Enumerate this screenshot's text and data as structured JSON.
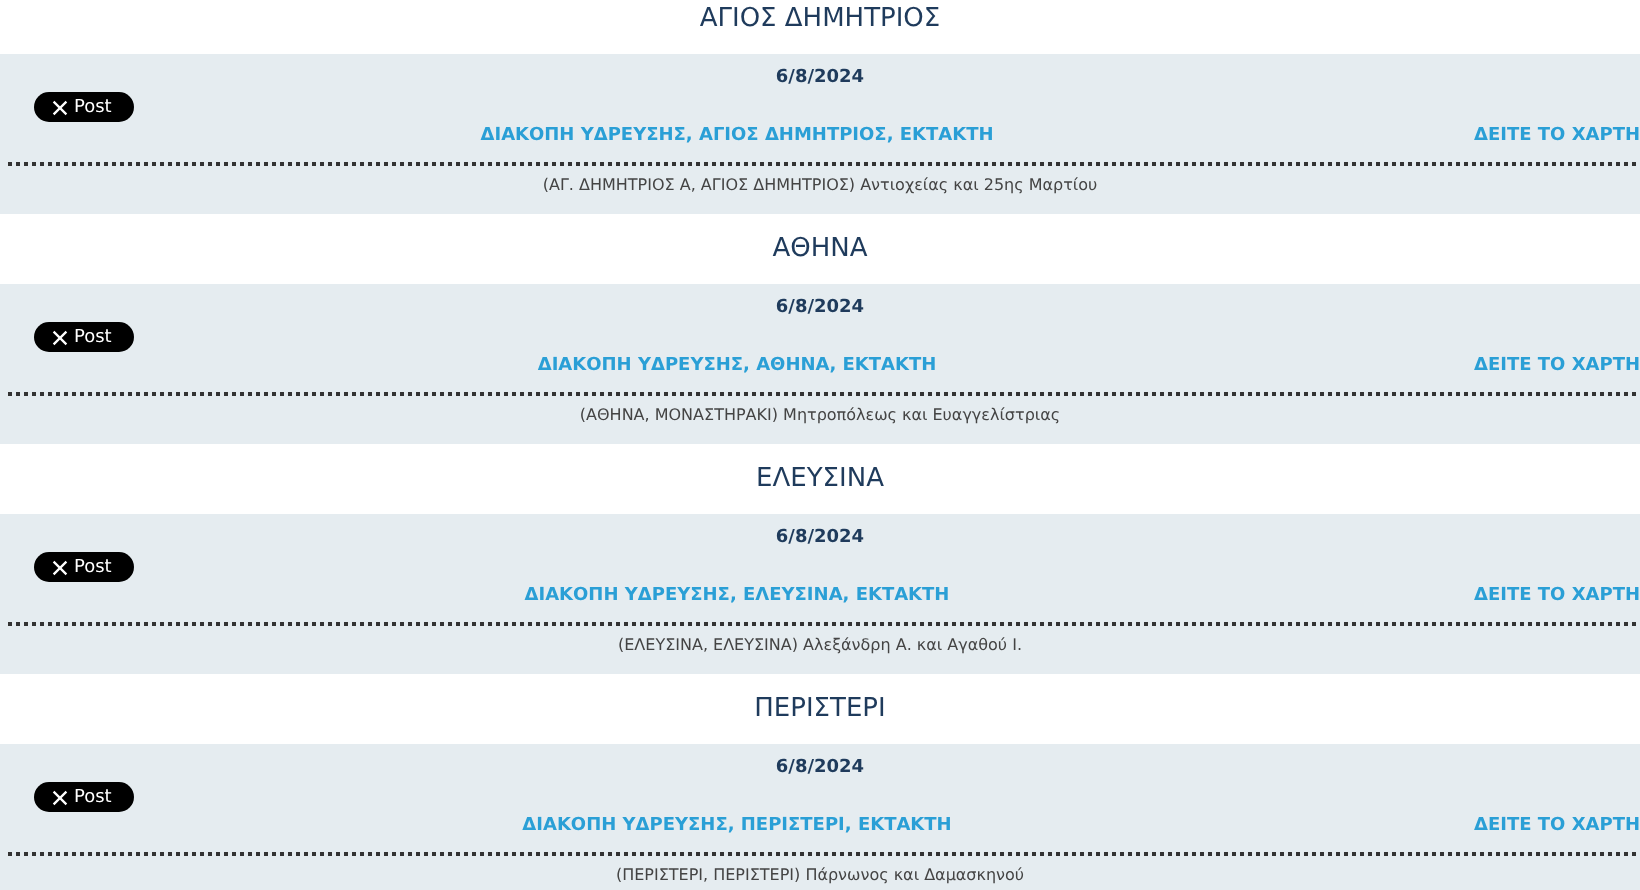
{
  "sections": [
    {
      "heading": "ΑΓΙΟΣ ΔΗΜΗΤΡΙΟΣ",
      "date": "6/8/2024",
      "post_button": "Post",
      "title": "ΔΙΑΚΟΠΗ ΥΔΡΕΥΣΗΣ, ΑΓΙΟΣ ΔΗΜΗΤΡΙΟΣ, ΕΚΤΑΚΤΗ",
      "map_link": "ΔΕΙΤΕ ΤΟ ΧΑΡΤΗ",
      "address": "(ΑΓ. ΔΗΜΗΤΡΙΟΣ Α, ΑΓΙΟΣ ΔΗΜΗΤΡΙΟΣ) Αντιοχείας και 25ης Μαρτίου"
    },
    {
      "heading": "ΑΘΗΝΑ",
      "date": "6/8/2024",
      "post_button": "Post",
      "title": "ΔΙΑΚΟΠΗ ΥΔΡΕΥΣΗΣ, ΑΘΗΝΑ, ΕΚΤΑΚΤΗ",
      "map_link": "ΔΕΙΤΕ ΤΟ ΧΑΡΤΗ",
      "address": "(ΑΘΗΝΑ, ΜΟΝΑΣΤΗΡΑΚΙ) Μητροπόλεως και Ευαγγελίστριας"
    },
    {
      "heading": "ΕΛΕΥΣΙΝΑ",
      "date": "6/8/2024",
      "post_button": "Post",
      "title": "ΔΙΑΚΟΠΗ ΥΔΡΕΥΣΗΣ, ΕΛΕΥΣΙΝΑ, ΕΚΤΑΚΤΗ",
      "map_link": "ΔΕΙΤΕ ΤΟ ΧΑΡΤΗ",
      "address": "(ΕΛΕΥΣΙΝΑ, ΕΛΕΥΣΙΝΑ) Αλεξάνδρη Α. και Αγαθού Ι."
    },
    {
      "heading": "ΠΕΡΙΣΤΕΡΙ",
      "date": "6/8/2024",
      "post_button": "Post",
      "title": "ΔΙΑΚΟΠΗ ΥΔΡΕΥΣΗΣ, ΠΕΡΙΣΤΕΡΙ, ΕΚΤΑΚΤΗ",
      "map_link": "ΔΕΙΤΕ ΤΟ ΧΑΡΤΗ",
      "address": "(ΠΕΡΙΣΤΕΡΙ, ΠΕΡΙΣΤΕΡΙ) Πάρνωνος και Δαμασκηνού"
    }
  ]
}
